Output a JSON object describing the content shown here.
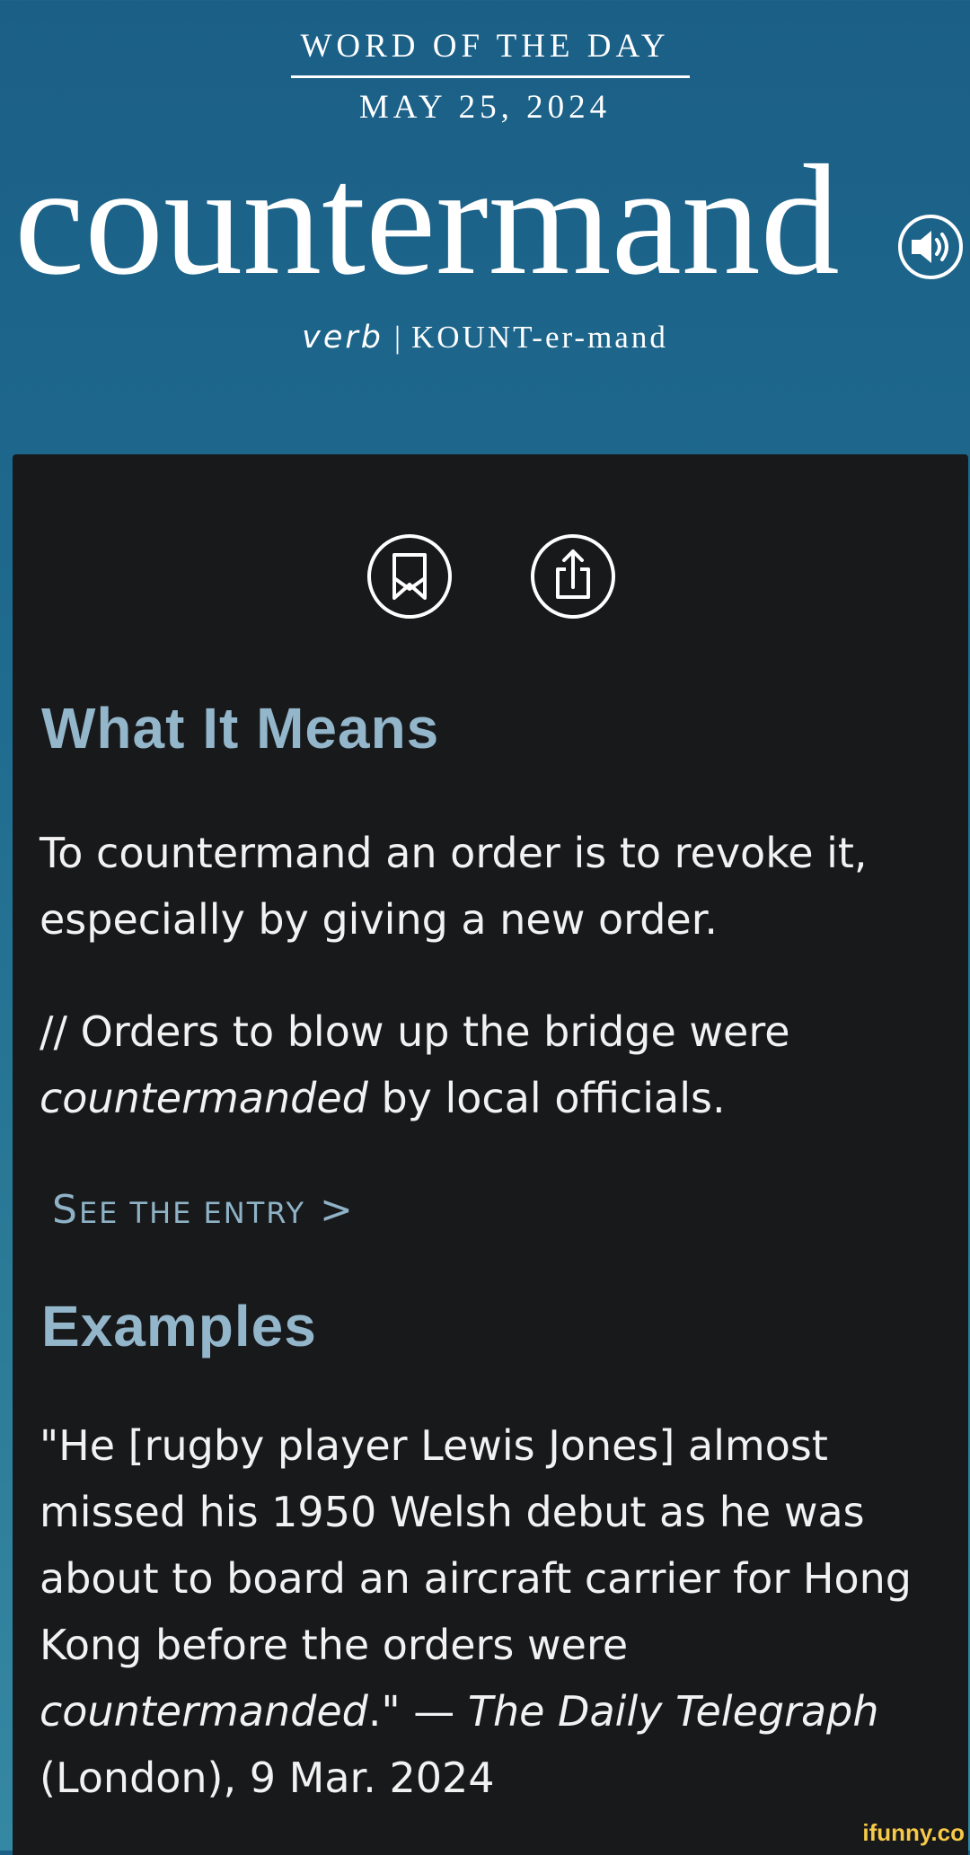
{
  "header": {
    "label": "WORD OF THE DAY",
    "date": "MAY 25, 2024",
    "word": "countermand",
    "part_of_speech": "verb",
    "separator": "|",
    "pronunciation": "KOUNT-er-mand",
    "audio_icon": "speaker-icon"
  },
  "actions": {
    "bookmark_icon": "bookmark-icon",
    "share_icon": "share-icon"
  },
  "meaning": {
    "title": "What It Means",
    "definition": "To countermand an order is to revoke it, especially by giving a new order.",
    "usage_prefix": "// Orders to blow up the bridge were ",
    "usage_italic": "countermanded",
    "usage_suffix": " by local officials.",
    "see_entry_first": "S",
    "see_entry_rest": "EE THE ENTRY",
    "see_entry_arrow": " >"
  },
  "examples": {
    "title": "Examples",
    "quote_part1": "\"He [rugby player Lewis Jones] almost missed his 1950 Welsh debut as he was about to board an aircraft carrier for Hong Kong before the orders were ",
    "quote_italic": "countermanded",
    "quote_part2": ".\" — ",
    "source": "The Daily Telegraph",
    "source_suffix": " (London), 9 Mar. 2024"
  },
  "watermark": "ifunny.co",
  "colors": {
    "header_bg": "#1b6088",
    "card_bg": "#18191b",
    "heading": "#93b6cb",
    "link": "#8fb2c7",
    "text": "#f2f2f2"
  }
}
